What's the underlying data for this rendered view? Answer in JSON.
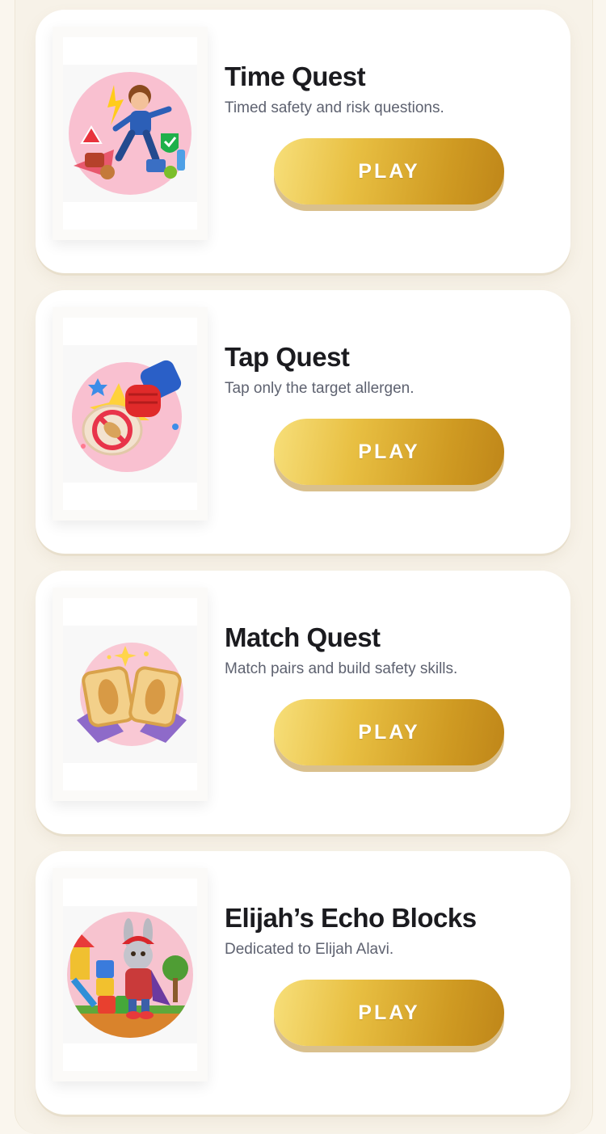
{
  "games": [
    {
      "title": "Time Quest",
      "description": "Timed safety and risk questions.",
      "play_label": "PLAY",
      "thumbnail_icon": "running-boy-safety-icon"
    },
    {
      "title": "Tap Quest",
      "description": "Tap only the target allergen.",
      "play_label": "PLAY",
      "thumbnail_icon": "fist-smash-peanut-icon"
    },
    {
      "title": "Match Quest",
      "description": "Match pairs and build safety skills.",
      "play_label": "PLAY",
      "thumbnail_icon": "peanut-match-cards-icon"
    },
    {
      "title": "Elijah’s Echo Blocks",
      "description": "Dedicated to Elijah Alavi.",
      "play_label": "PLAY",
      "thumbnail_icon": "bunny-blocks-icon"
    }
  ],
  "colors": {
    "accent_gold": "#d9a52c",
    "title_text": "#1b1b1f",
    "description_text": "#5e6270",
    "thumbnail_circle": "#f9c6d3"
  }
}
